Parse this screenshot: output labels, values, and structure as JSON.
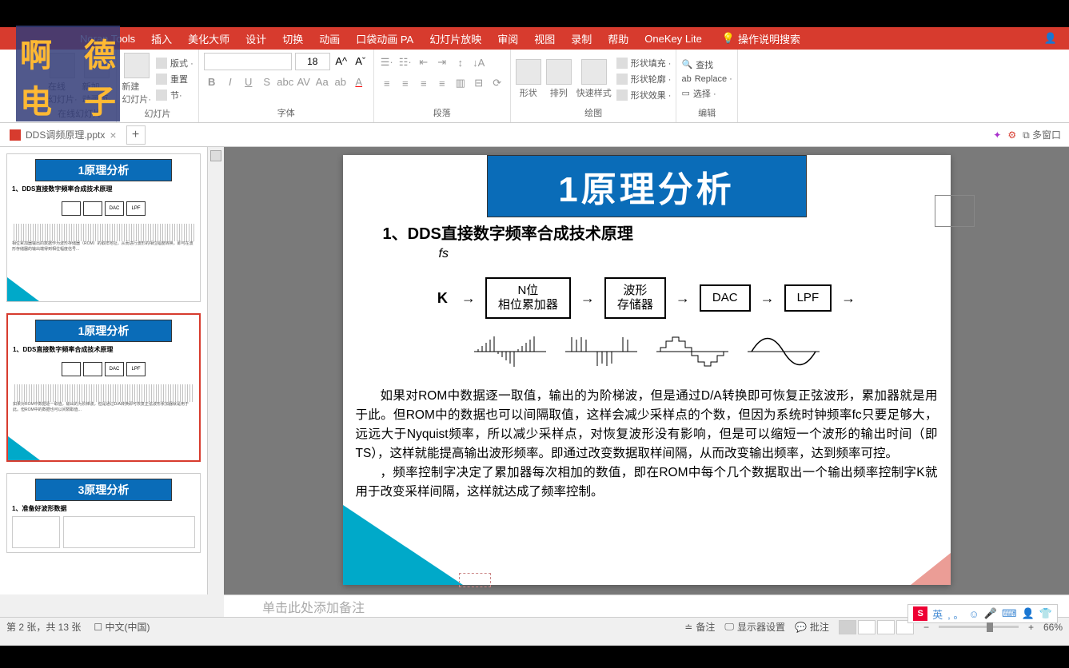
{
  "logo": {
    "tl": "啊",
    "tr": "德",
    "bl": "电",
    "br": "子"
  },
  "menu": {
    "items": [
      "Noran Tools",
      "插入",
      "美化大师",
      "设计",
      "切换",
      "动画",
      "口袋动画 PA",
      "幻灯片放映",
      "审阅",
      "视图",
      "录制",
      "帮助",
      "OneKey Lite"
    ],
    "search": "操作说明搜索"
  },
  "ribbon": {
    "g1": {
      "btn1": "在线\n幻灯片·",
      "btn2": "新加\n动画页·",
      "label": "在线幻灯片"
    },
    "g2": {
      "btn1": "新建\n幻灯片·",
      "row1": "版式 ·",
      "row2": "重置",
      "row3": "节·",
      "label": "幻灯片"
    },
    "font": {
      "size": "18",
      "label": "字体"
    },
    "para": {
      "label": "段落"
    },
    "draw": {
      "btn1": "形状",
      "btn2": "排列",
      "btn3": "快速样式",
      "r1": "形状填充 ·",
      "r2": "形状轮廓 ·",
      "r3": "形状效果 ·",
      "label": "绘图"
    },
    "edit": {
      "r1": "查找",
      "r2": "Replace ·",
      "r3": "选择 ·",
      "label": "编辑"
    }
  },
  "tab": {
    "name": "DDS调频原理.pptx",
    "right": "多窗口"
  },
  "thumbs": {
    "t1": "1原理分析",
    "s1": "1、DDS直接数字频率合成技术原理",
    "t2": "1原理分析",
    "s2": "1、DDS直接数字频率合成技术原理",
    "t3": "3原理分析",
    "s3": "1、准备好波形数据"
  },
  "slide": {
    "title": "1原理分析",
    "sub": "1、DDS直接数字频率合成技术原理",
    "fs": "fs",
    "k": "K",
    "boxes": [
      "N位\n相位累加器",
      "波形\n存储器",
      "DAC",
      "LPF"
    ],
    "p1": "如果对ROM中数据逐一取值，输出的为阶梯波，但是通过D/A转换即可恢复正弦波形，累加器就是用于此。但ROM中的数据也可以间隔取值，这样会减少采样点的个数，但因为系统时钟频率fc只要足够大，远远大于Nyquist频率，所以减少采样点，对恢复波形没有影响，但是可以缩短一个波形的输出时间（即TS），这样就能提高输出波形频率。即通过改变数据取样间隔，从而改变输出频率，达到频率可控。",
    "p2": "，频率控制字决定了累加器每次相加的数值，即在ROM中每个几个数据取出一个输出频率控制字K就用于改变采样间隔，这样就达成了频率控制。"
  },
  "notes": "单击此处添加备注",
  "ime": {
    "lang": "英"
  },
  "status": {
    "page": "第 2 张，共 13 张",
    "lang": "中文(中国)",
    "notes": "备注",
    "display": "显示器设置",
    "comment": "批注",
    "zoom": "66%"
  }
}
